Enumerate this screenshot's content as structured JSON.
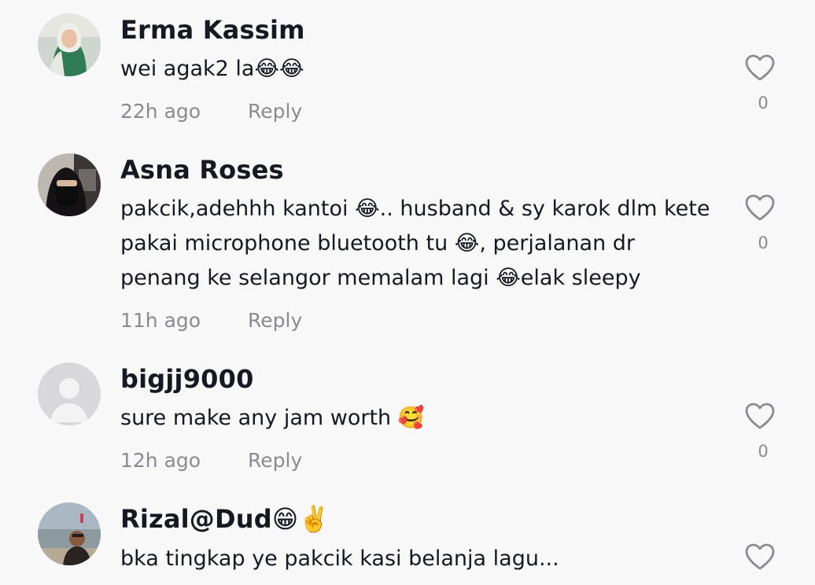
{
  "comments": [
    {
      "username": "Erma Kassim",
      "text": "wei agak2 la😂😂",
      "time": "22h ago",
      "reply_label": "Reply",
      "likes": "0",
      "avatar_icon": "user-photo-avatar"
    },
    {
      "username": "Asna Roses",
      "text": "pakcik,adehhh kantoi 😂.. husband & sy karok dlm kete pakai microphone bluetooth tu 😂, perjalanan dr penang ke selangor memalam lagi 😂elak sleepy",
      "time": "11h ago",
      "reply_label": "Reply",
      "likes": "0",
      "avatar_icon": "user-photo-avatar"
    },
    {
      "username": "bigjj9000",
      "text": "sure make any jam worth 🥰",
      "time": "12h ago",
      "reply_label": "Reply",
      "likes": "0",
      "avatar_icon": "default-person-avatar"
    },
    {
      "username": "Rizal@Dud😁✌️",
      "text": "bka tingkap ye pakcik kasi belanja lagu...",
      "avatar_icon": "user-photo-avatar"
    }
  ],
  "icons": {
    "like": "heart-outline-icon"
  },
  "colors": {
    "background": "#f8f8f8",
    "username": "#161823",
    "meta": "#8a8b91"
  }
}
